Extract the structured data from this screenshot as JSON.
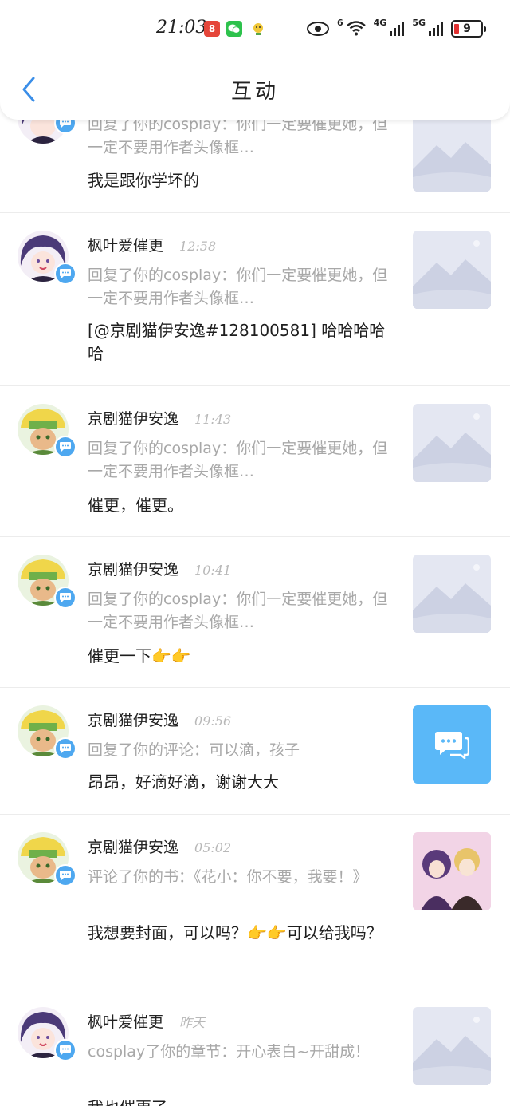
{
  "status": {
    "time": "21:03",
    "battery": "9",
    "net_4g": "4G",
    "net_5g": "5G",
    "wifi_tag": "6"
  },
  "nav": {
    "title": "互动"
  },
  "items": [
    {
      "name": "",
      "time": "",
      "quote": "回复了你的cosplay：你们一定要催更她，但一定不要用作者头像框…",
      "content": "我是跟你学坏的",
      "avatar": "purple-hair-avatar",
      "thumb": "placeholder"
    },
    {
      "name": "枫叶爱催更",
      "time": "12:58",
      "quote": "回复了你的cosplay：你们一定要催更她，但一定不要用作者头像框…",
      "content": "[@京剧猫伊安逸#128100581] 哈哈哈哈哈",
      "avatar": "purple-hair-avatar",
      "thumb": "placeholder"
    },
    {
      "name": "京剧猫伊安逸",
      "time": "11:43",
      "quote": "回复了你的cosplay：你们一定要催更她，但一定不要用作者头像框…",
      "content": "催更，催更。",
      "avatar": "green-hat-avatar",
      "thumb": "placeholder"
    },
    {
      "name": "京剧猫伊安逸",
      "time": "10:41",
      "quote": "回复了你的cosplay：你们一定要催更她，但一定不要用作者头像框…",
      "content": "催更一下👉👉",
      "avatar": "green-hat-avatar",
      "thumb": "placeholder"
    },
    {
      "name": "京剧猫伊安逸",
      "time": "09:56",
      "quote": "回复了你的评论：可以滴，孩子",
      "content": "昂昂，好滴好滴，谢谢大大",
      "avatar": "green-hat-avatar",
      "thumb": "message"
    },
    {
      "name": "京剧猫伊安逸",
      "time": "05:02",
      "quote": "评论了你的书：《花小：你不要，我要！》",
      "content": "我想要封面，可以吗？👉👉可以给我吗？",
      "avatar": "green-hat-avatar",
      "thumb": "book-cover"
    },
    {
      "name": "枫叶爱催更",
      "time": "昨天",
      "quote": "cosplay了你的章节：开心表白~开甜成！",
      "content": "我也催更了",
      "avatar": "purple-hair-avatar",
      "thumb": "placeholder"
    }
  ],
  "colors": {
    "badge": "#4ea8f0",
    "msg_thumb": "#5ab8f8",
    "back_arrow": "#3a8ee8"
  }
}
